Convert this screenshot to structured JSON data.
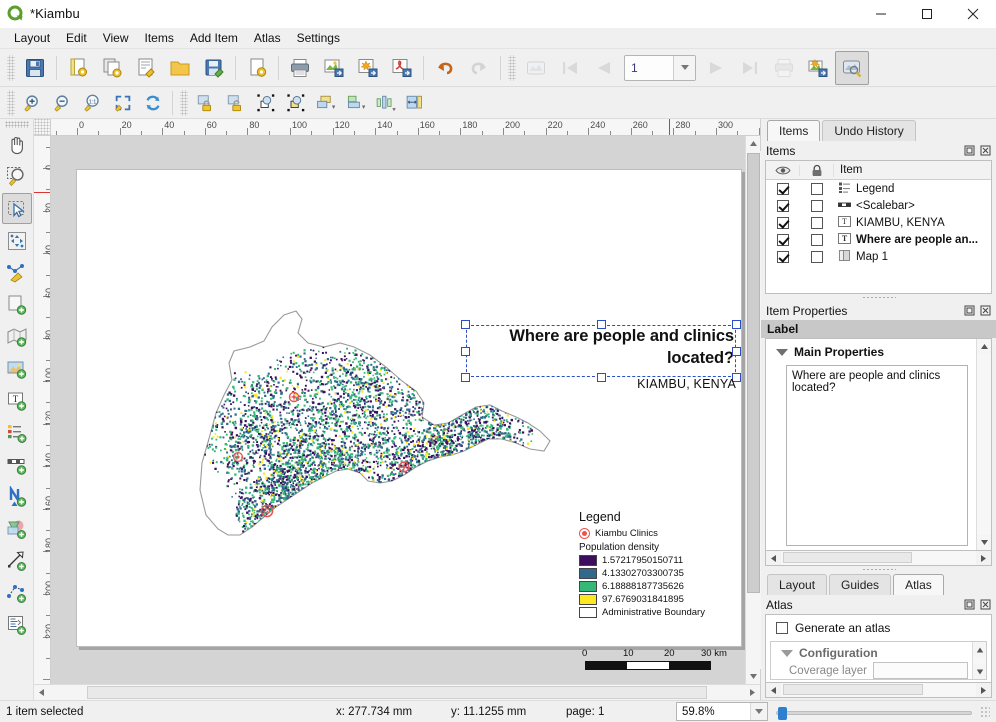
{
  "window": {
    "title": "*Kiambu",
    "logo_icon": "qgis-logo-icon",
    "minimize_label": "–",
    "maximize_label": "□",
    "close_label": "✕"
  },
  "menubar": {
    "items": [
      {
        "label": "Layout",
        "name": "menu-layout"
      },
      {
        "label": "Edit",
        "name": "menu-edit"
      },
      {
        "label": "View",
        "name": "menu-view"
      },
      {
        "label": "Items",
        "name": "menu-items"
      },
      {
        "label": "Add Item",
        "name": "menu-add-item"
      },
      {
        "label": "Atlas",
        "name": "menu-atlas"
      },
      {
        "label": "Settings",
        "name": "menu-settings"
      }
    ]
  },
  "toolbar_main": {
    "buttons": [
      {
        "name": "save-project-button",
        "icon": "floppy-disk-icon",
        "tooltip": "Save Project"
      },
      {
        "name": "new-layout-button",
        "icon": "new-layout-icon",
        "tooltip": "New Layout"
      },
      {
        "name": "duplicate-layout-button",
        "icon": "duplicate-layout-icon",
        "tooltip": "Duplicate Layout"
      },
      {
        "name": "layout-manager-button",
        "icon": "layout-manager-icon",
        "tooltip": "Layout Manager"
      },
      {
        "name": "open-template-button",
        "icon": "folder-icon",
        "tooltip": "Add Items from Template"
      },
      {
        "name": "save-template-button",
        "icon": "save-template-icon",
        "tooltip": "Save as Template"
      },
      {
        "name": "layout-properties-button",
        "icon": "page-properties-icon",
        "tooltip": "Layout Properties"
      },
      {
        "name": "print-button",
        "icon": "printer-icon",
        "tooltip": "Print Layout"
      },
      {
        "name": "export-image-button",
        "icon": "export-image-icon",
        "tooltip": "Export as Image"
      },
      {
        "name": "export-svg-button",
        "icon": "export-svg-icon",
        "tooltip": "Export as SVG"
      },
      {
        "name": "export-pdf-button",
        "icon": "export-pdf-icon",
        "tooltip": "Export as PDF"
      },
      {
        "name": "undo-button",
        "icon": "undo-arrow-icon",
        "tooltip": "Undo"
      },
      {
        "name": "redo-button",
        "icon": "redo-arrow-icon",
        "tooltip": "Redo"
      },
      {
        "name": "atlas-preview-button",
        "icon": "atlas-preview-icon",
        "tooltip": "Preview Atlas"
      },
      {
        "name": "atlas-first-button",
        "icon": "first-feature-icon",
        "tooltip": "First Feature"
      },
      {
        "name": "atlas-prev-button",
        "icon": "previous-feature-icon",
        "tooltip": "Previous Feature"
      }
    ],
    "page_value": "1",
    "buttons_after": [
      {
        "name": "atlas-next-button",
        "icon": "next-feature-icon",
        "tooltip": "Next Feature"
      },
      {
        "name": "atlas-last-button",
        "icon": "last-feature-icon",
        "tooltip": "Last Feature"
      },
      {
        "name": "atlas-print-button",
        "icon": "printer-icon",
        "tooltip": "Print Atlas"
      },
      {
        "name": "atlas-export-image-button",
        "icon": "atlas-export-image-icon",
        "tooltip": "Export Atlas as Image"
      },
      {
        "name": "atlas-settings-button",
        "icon": "atlas-settings-icon",
        "tooltip": "Atlas Settings"
      }
    ]
  },
  "toolbar_nav": {
    "buttons": [
      {
        "name": "zoom-in-button",
        "icon": "zoom-in-icon"
      },
      {
        "name": "zoom-out-button",
        "icon": "zoom-out-icon"
      },
      {
        "name": "zoom-full-button",
        "icon": "zoom-one-to-one-icon"
      },
      {
        "name": "zoom-to-extent-button",
        "icon": "zoom-full-extent-icon"
      },
      {
        "name": "refresh-view-button",
        "icon": "refresh-icon"
      },
      {
        "name": "lock-items-button",
        "icon": "lock-items-icon"
      },
      {
        "name": "unlock-items-button",
        "icon": "unlock-items-icon"
      },
      {
        "name": "group-items-button",
        "icon": "group-items-icon"
      },
      {
        "name": "ungroup-items-button",
        "icon": "ungroup-items-icon"
      },
      {
        "name": "raise-items-button",
        "icon": "raise-items-icon"
      },
      {
        "name": "align-items-button",
        "icon": "align-items-icon"
      },
      {
        "name": "distribute-items-button",
        "icon": "distribute-items-icon"
      },
      {
        "name": "resize-items-button",
        "icon": "resize-items-icon"
      }
    ]
  },
  "toolbox": {
    "buttons": [
      {
        "name": "pan-layout-tool",
        "icon": "pan-hand-icon",
        "active": false
      },
      {
        "name": "zoom-tool",
        "icon": "zoom-magnifier-icon",
        "active": false
      },
      {
        "name": "select-move-item-tool",
        "icon": "select-arrow-icon",
        "active": true
      },
      {
        "name": "move-item-content-tool",
        "icon": "move-content-icon",
        "active": false
      },
      {
        "name": "edit-nodes-tool",
        "icon": "edit-nodes-icon",
        "active": false
      },
      {
        "name": "add-page-tool",
        "icon": "add-page-icon",
        "active": false
      },
      {
        "name": "add-map-tool",
        "icon": "add-map-icon",
        "active": false
      },
      {
        "name": "add-picture-tool",
        "icon": "add-picture-icon",
        "active": false
      },
      {
        "name": "add-label-tool",
        "icon": "add-label-icon",
        "active": false
      },
      {
        "name": "add-legend-tool",
        "icon": "add-legend-icon",
        "active": false
      },
      {
        "name": "add-scalebar-tool",
        "icon": "add-scalebar-icon",
        "active": false
      },
      {
        "name": "add-north-arrow-tool",
        "icon": "add-north-arrow-icon",
        "active": false
      },
      {
        "name": "add-shape-tool",
        "icon": "add-shape-icon",
        "active": false
      },
      {
        "name": "add-arrow-tool",
        "icon": "add-arrow-icon",
        "active": false
      },
      {
        "name": "add-node-item-tool",
        "icon": "add-node-item-icon",
        "active": false
      },
      {
        "name": "add-html-tool",
        "icon": "add-html-icon",
        "active": false
      }
    ]
  },
  "rulers": {
    "horizontal_labels": [
      "0",
      "20",
      "40",
      "60",
      "80",
      "100",
      "120",
      "140",
      "160",
      "180",
      "200",
      "220",
      "240",
      "260",
      "280",
      "300"
    ],
    "vertical_labels": [
      "0",
      "20",
      "40",
      "60",
      "80",
      "100",
      "120",
      "140",
      "160",
      "180",
      "200",
      "220"
    ],
    "unit": "mm"
  },
  "composition": {
    "title": {
      "text": "Where are people and clinics located?",
      "selected": true
    },
    "subtitle": {
      "text": "KIAMBU, KENYA"
    },
    "legend": {
      "heading": "Legend",
      "point_layer": {
        "label": "Kiambu Clinics",
        "symbol": "circle-target-icon",
        "color": "#e8544f"
      },
      "raster_heading": "Population density",
      "classes": [
        {
          "label": "1.57217950150711",
          "color": "#3b0f5e"
        },
        {
          "label": "4.13302703300735",
          "color": "#31688e"
        },
        {
          "label": "6.18888187735626",
          "color": "#35b779"
        },
        {
          "label": "97.6769031841895",
          "color": "#fde725"
        }
      ],
      "boundary": {
        "label": "Administrative Boundary",
        "color": "#ffffff"
      }
    },
    "scalebar": {
      "labels": [
        "0",
        "10",
        "20",
        "30 km"
      ],
      "segments": 3
    }
  },
  "right_panel": {
    "top_tabs": [
      {
        "label": "Items",
        "name": "tab-items",
        "selected": true
      },
      {
        "label": "Undo History",
        "name": "tab-undo-history",
        "selected": false
      }
    ],
    "items_dock": {
      "title": "Items",
      "columns": [
        "visibility",
        "lock",
        "Item"
      ],
      "item_column_label": "Item",
      "rows": [
        {
          "label": "Legend",
          "icon": "legend-item-icon",
          "visible": true,
          "locked": false,
          "bold": false
        },
        {
          "label": "<Scalebar>",
          "icon": "scalebar-item-icon",
          "visible": true,
          "locked": false,
          "bold": false
        },
        {
          "label": "KIAMBU, KENYA",
          "icon": "text-label-icon",
          "visible": true,
          "locked": false,
          "bold": false
        },
        {
          "label": "Where are people an...",
          "icon": "text-label-icon",
          "visible": true,
          "locked": false,
          "bold": true
        },
        {
          "label": "Map 1",
          "icon": "map-item-icon",
          "visible": true,
          "locked": false,
          "bold": false
        }
      ]
    },
    "item_properties": {
      "title": "Item Properties",
      "section_label": "Label",
      "main_properties_label": "Main Properties",
      "text_value": "Where are people and clinics located?"
    },
    "bottom_tabs": [
      {
        "label": "Layout",
        "name": "tab-layout",
        "selected": false
      },
      {
        "label": "Guides",
        "name": "tab-guides",
        "selected": false
      },
      {
        "label": "Atlas",
        "name": "tab-atlas",
        "selected": true
      }
    ],
    "atlas_dock": {
      "title": "Atlas",
      "generate_label": "Generate an atlas",
      "generate_checked": false,
      "configuration_label": "Configuration",
      "coverage_layer_label": "Coverage layer",
      "coverage_layer_value": ""
    }
  },
  "statusbar": {
    "selection": "1 item selected",
    "x_label": "x: 277.734 mm",
    "y_label": "y: 11.1255 mm",
    "page_label": "page: 1",
    "zoom_value": "59.8%"
  }
}
